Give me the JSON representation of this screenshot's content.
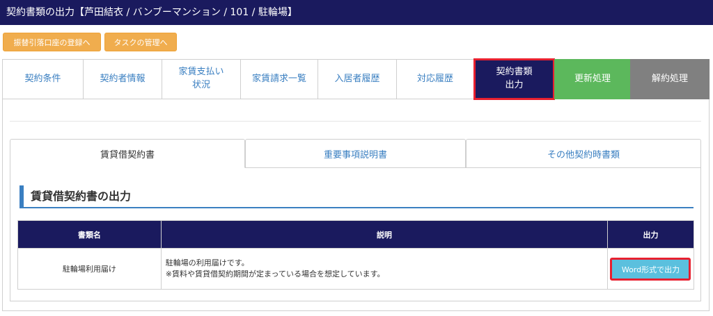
{
  "header": {
    "title": "契約書類の出力【芦田結衣 / バンブーマンション / 101 / 駐輪場】"
  },
  "top_buttons": {
    "bank_registration": "振替引落口座の登録へ",
    "task_management": "タスクの管理へ"
  },
  "tabs": [
    {
      "label": "契約条件"
    },
    {
      "label": "契約者情報"
    },
    {
      "label": "家賃支払い\n状況"
    },
    {
      "label": "家賃請求一覧"
    },
    {
      "label": "入居者履歴"
    },
    {
      "label": "対応履歴"
    },
    {
      "label": "契約書類\n出力",
      "active": true
    },
    {
      "label": "更新処理"
    },
    {
      "label": "解約処理"
    }
  ],
  "subtabs": [
    {
      "label": "賃貸借契約書",
      "active": true
    },
    {
      "label": "重要事項説明書"
    },
    {
      "label": "その他契約時書類"
    }
  ],
  "section": {
    "title": "賃貸借契約書の出力"
  },
  "table": {
    "headers": [
      "書類名",
      "説明",
      "出力"
    ],
    "rows": [
      {
        "name": "駐輪場利用届け",
        "desc_line1": "駐輪場の利用届けです。",
        "desc_line2": "※賃料や賃貸借契約期間が定まっている場合を想定しています。",
        "button": "Word形式で出力"
      }
    ]
  },
  "colors": {
    "navy": "#1a1a5e",
    "orange": "#f0ad4e",
    "green": "#5cb85c",
    "gray": "#808080",
    "link_blue": "#3a7fc1",
    "highlight_red": "#e8202f",
    "button_cyan": "#5bc0de"
  }
}
